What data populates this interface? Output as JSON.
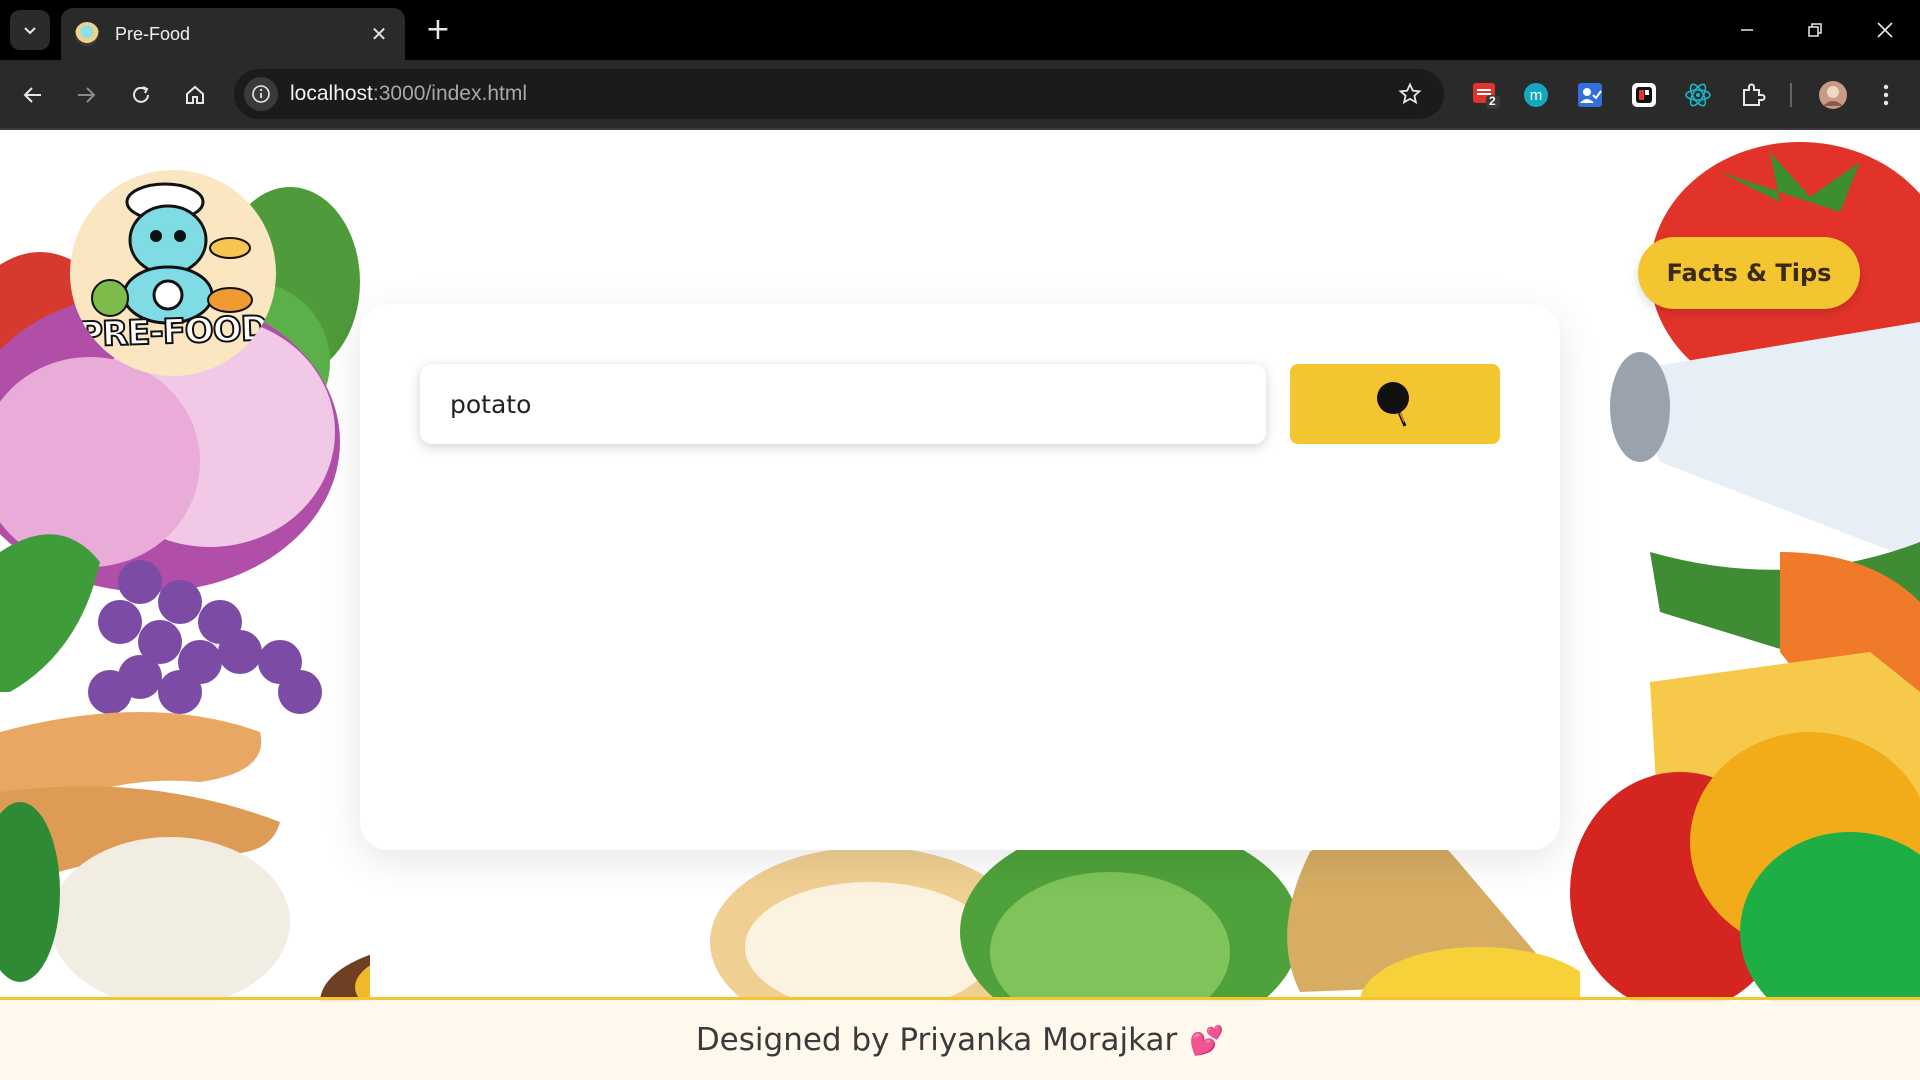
{
  "browser": {
    "tab_title": "Pre-Food",
    "url_host": "localhost",
    "url_rest": ":3000/index.html",
    "extensions": [
      {
        "name": "todoist-extension-icon",
        "badge": "2"
      },
      {
        "name": "m-extension-icon"
      },
      {
        "name": "contacts-extension-icon"
      },
      {
        "name": "app-extension-icon"
      },
      {
        "name": "react-devtools-icon"
      },
      {
        "name": "extensions-puzzle-icon"
      }
    ]
  },
  "page": {
    "logo_text": "PRE-FOOD",
    "facts_button_label": "Facts & Tips",
    "search": {
      "value": "potato",
      "placeholder": ""
    },
    "footer_text": "Designed by Priyanka Morajkar",
    "footer_emoji": "💕"
  },
  "colors": {
    "accent_yellow": "#f2c531",
    "chrome_dark": "#2a2a2a",
    "tabstrip": "#000000"
  }
}
